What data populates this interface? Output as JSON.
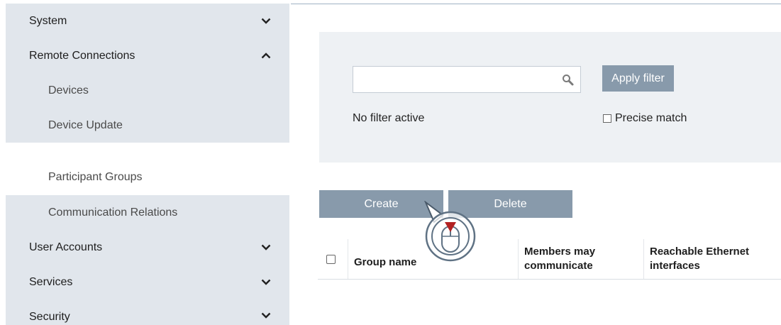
{
  "sidebar": {
    "items": [
      {
        "label": "System",
        "level": "top",
        "expanded": false
      },
      {
        "label": "Remote Connections",
        "level": "top",
        "expanded": true
      },
      {
        "label": "Devices",
        "level": "sub"
      },
      {
        "label": "Device Update",
        "level": "sub"
      },
      {
        "label": "Participant Groups",
        "level": "sub",
        "selected": true
      },
      {
        "label": "Communication Relations",
        "level": "sub"
      },
      {
        "label": "User Accounts",
        "level": "top",
        "expanded": false
      },
      {
        "label": "Services",
        "level": "top",
        "expanded": false
      },
      {
        "label": "Security",
        "level": "top",
        "expanded": false
      }
    ]
  },
  "filter": {
    "search_value": "",
    "search_icon": "search-icon",
    "apply_label": "Apply filter",
    "status": "No filter active",
    "precise_label": "Precise match",
    "precise_checked": false
  },
  "actions": {
    "create_label": "Create",
    "delete_label": "Delete"
  },
  "table": {
    "columns": [
      "Group name",
      "Members may communicate",
      "Reachable Ethernet interfaces"
    ]
  },
  "colors": {
    "sidebar_bg": "#e1e6ec",
    "button_bg": "#889aab",
    "panel_bg": "#eef1f4",
    "cursor_accent": "#b22222"
  }
}
